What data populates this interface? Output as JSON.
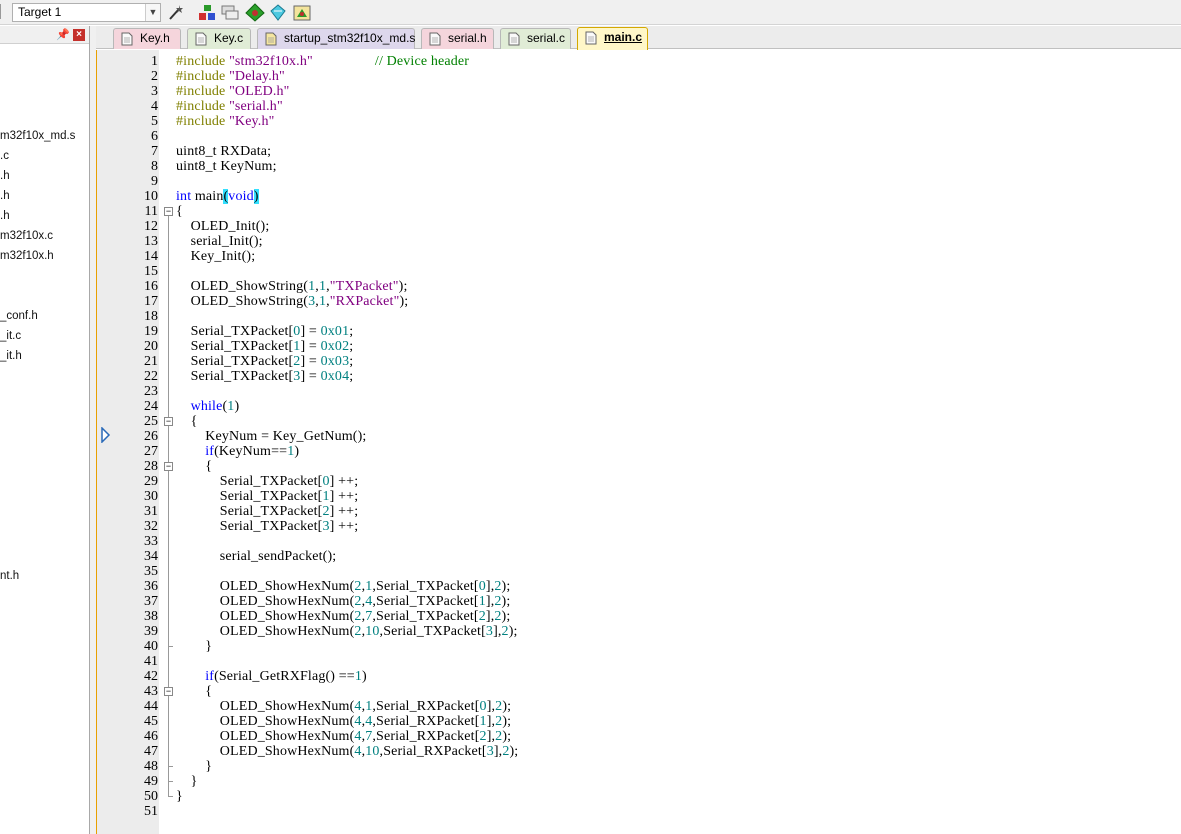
{
  "toolbar": {
    "target": "Target 1",
    "buttons": [
      "wand-icon",
      "load-icon",
      "multi-project-icon",
      "manage-components-icon",
      "select-packs-icon",
      "runtime-env-icon"
    ]
  },
  "sidebar": {
    "pin": "p",
    "close": "×",
    "items": [
      {
        "label": "m32f10x_md.s",
        "row": 0
      },
      {
        "label": ".c",
        "row": 1
      },
      {
        "label": ".h",
        "row": 2
      },
      {
        "label": ".h",
        "row": 3
      },
      {
        "label": ".h",
        "row": 4
      },
      {
        "label": "m32f10x.c",
        "row": 5
      },
      {
        "label": "m32f10x.h",
        "row": 6
      },
      {
        "label": "_conf.h",
        "row": 9
      },
      {
        "label": "_it.c",
        "row": 10
      },
      {
        "label": "_it.h",
        "row": 11
      },
      {
        "label": "nt.h",
        "row": 22
      }
    ]
  },
  "tabs": [
    {
      "label": "Key.h",
      "kind": "h"
    },
    {
      "label": "Key.c",
      "kind": "c"
    },
    {
      "label": "startup_stm32f10x_md.s",
      "kind": "s"
    },
    {
      "label": "serial.h",
      "kind": "h"
    },
    {
      "label": "serial.c",
      "kind": "c"
    },
    {
      "label": "main.c",
      "kind": "c",
      "active": true
    }
  ],
  "editor": {
    "current_line": 26,
    "folds": [
      11,
      25,
      28,
      43
    ],
    "lines": [
      {
        "n": "1",
        "tokens": [
          [
            "pp",
            "#include "
          ],
          [
            "str",
            "\"stm32f10x.h\""
          ],
          [
            "",
            "                 "
          ],
          [
            "cm",
            "// Device header"
          ]
        ]
      },
      {
        "n": "2",
        "tokens": [
          [
            "pp",
            "#include "
          ],
          [
            "str",
            "\"Delay.h\""
          ]
        ]
      },
      {
        "n": "3",
        "tokens": [
          [
            "pp",
            "#include "
          ],
          [
            "str",
            "\"OLED.h\""
          ]
        ]
      },
      {
        "n": "4",
        "tokens": [
          [
            "pp",
            "#include "
          ],
          [
            "str",
            "\"serial.h\""
          ]
        ]
      },
      {
        "n": "5",
        "tokens": [
          [
            "pp",
            "#include "
          ],
          [
            "str",
            "\"Key.h\""
          ]
        ]
      },
      {
        "n": "6",
        "tokens": []
      },
      {
        "n": "7",
        "tokens": [
          [
            "",
            "uint8_t RXData;"
          ]
        ]
      },
      {
        "n": "8",
        "tokens": [
          [
            "",
            "uint8_t KeyNum;"
          ]
        ]
      },
      {
        "n": "9",
        "tokens": []
      },
      {
        "n": "10",
        "tokens": [
          [
            "kw",
            "int"
          ],
          [
            "",
            " main"
          ],
          [
            "hl",
            "("
          ],
          [
            "kw",
            "void"
          ],
          [
            "hl",
            ")"
          ]
        ]
      },
      {
        "n": "11",
        "tokens": [
          [
            "",
            "{"
          ]
        ]
      },
      {
        "n": "12",
        "tokens": [
          [
            "",
            "    OLED_Init();"
          ]
        ]
      },
      {
        "n": "13",
        "tokens": [
          [
            "",
            "    serial_Init();"
          ]
        ]
      },
      {
        "n": "14",
        "tokens": [
          [
            "",
            "    Key_Init();"
          ]
        ]
      },
      {
        "n": "15",
        "tokens": []
      },
      {
        "n": "16",
        "tokens": [
          [
            "",
            "    OLED_ShowString("
          ],
          [
            "num",
            "1"
          ],
          [
            "",
            ","
          ],
          [
            "num",
            "1"
          ],
          [
            "",
            ","
          ],
          [
            "str",
            "\"TXPacket\""
          ],
          [
            "",
            ");"
          ]
        ]
      },
      {
        "n": "17",
        "tokens": [
          [
            "",
            "    OLED_ShowString("
          ],
          [
            "num",
            "3"
          ],
          [
            "",
            ","
          ],
          [
            "num",
            "1"
          ],
          [
            "",
            ","
          ],
          [
            "str",
            "\"RXPacket\""
          ],
          [
            "",
            ");"
          ]
        ]
      },
      {
        "n": "18",
        "tokens": []
      },
      {
        "n": "19",
        "tokens": [
          [
            "",
            "    Serial_TXPacket["
          ],
          [
            "num",
            "0"
          ],
          [
            "",
            "] = "
          ],
          [
            "num",
            "0x01"
          ],
          [
            "",
            ";"
          ]
        ]
      },
      {
        "n": "20",
        "tokens": [
          [
            "",
            "    Serial_TXPacket["
          ],
          [
            "num",
            "1"
          ],
          [
            "",
            "] = "
          ],
          [
            "num",
            "0x02"
          ],
          [
            "",
            ";"
          ]
        ]
      },
      {
        "n": "21",
        "tokens": [
          [
            "",
            "    Serial_TXPacket["
          ],
          [
            "num",
            "2"
          ],
          [
            "",
            "] = "
          ],
          [
            "num",
            "0x03"
          ],
          [
            "",
            ";"
          ]
        ]
      },
      {
        "n": "22",
        "tokens": [
          [
            "",
            "    Serial_TXPacket["
          ],
          [
            "num",
            "3"
          ],
          [
            "",
            "] = "
          ],
          [
            "num",
            "0x04"
          ],
          [
            "",
            ";"
          ]
        ]
      },
      {
        "n": "23",
        "tokens": []
      },
      {
        "n": "24",
        "tokens": [
          [
            "kw",
            "    while"
          ],
          [
            "",
            "("
          ],
          [
            "num",
            "1"
          ],
          [
            "",
            ")"
          ]
        ]
      },
      {
        "n": "25",
        "tokens": [
          [
            "",
            "    {"
          ]
        ]
      },
      {
        "n": "26",
        "tokens": [
          [
            "",
            "        KeyNum = Key_GetNum();"
          ]
        ]
      },
      {
        "n": "27",
        "tokens": [
          [
            "kw",
            "        if"
          ],
          [
            "",
            "(KeyNum=="
          ],
          [
            "num",
            "1"
          ],
          [
            "",
            ")"
          ]
        ]
      },
      {
        "n": "28",
        "tokens": [
          [
            "",
            "        {"
          ]
        ]
      },
      {
        "n": "29",
        "tokens": [
          [
            "",
            "            Serial_TXPacket["
          ],
          [
            "num",
            "0"
          ],
          [
            "",
            "] ++;"
          ]
        ]
      },
      {
        "n": "30",
        "tokens": [
          [
            "",
            "            Serial_TXPacket["
          ],
          [
            "num",
            "1"
          ],
          [
            "",
            "] ++;"
          ]
        ]
      },
      {
        "n": "31",
        "tokens": [
          [
            "",
            "            Serial_TXPacket["
          ],
          [
            "num",
            "2"
          ],
          [
            "",
            "] ++;"
          ]
        ]
      },
      {
        "n": "32",
        "tokens": [
          [
            "",
            "            Serial_TXPacket["
          ],
          [
            "num",
            "3"
          ],
          [
            "",
            "] ++;"
          ]
        ]
      },
      {
        "n": "33",
        "tokens": []
      },
      {
        "n": "34",
        "tokens": [
          [
            "",
            "            serial_sendPacket();"
          ]
        ]
      },
      {
        "n": "35",
        "tokens": []
      },
      {
        "n": "36",
        "tokens": [
          [
            "",
            "            OLED_ShowHexNum("
          ],
          [
            "num",
            "2"
          ],
          [
            "",
            ","
          ],
          [
            "num",
            "1"
          ],
          [
            "",
            ",Serial_TXPacket["
          ],
          [
            "num",
            "0"
          ],
          [
            "",
            "],"
          ],
          [
            "num",
            "2"
          ],
          [
            "",
            ");"
          ]
        ]
      },
      {
        "n": "37",
        "tokens": [
          [
            "",
            "            OLED_ShowHexNum("
          ],
          [
            "num",
            "2"
          ],
          [
            "",
            ","
          ],
          [
            "num",
            "4"
          ],
          [
            "",
            ",Serial_TXPacket["
          ],
          [
            "num",
            "1"
          ],
          [
            "",
            "],"
          ],
          [
            "num",
            "2"
          ],
          [
            "",
            ");"
          ]
        ]
      },
      {
        "n": "38",
        "tokens": [
          [
            "",
            "            OLED_ShowHexNum("
          ],
          [
            "num",
            "2"
          ],
          [
            "",
            ","
          ],
          [
            "num",
            "7"
          ],
          [
            "",
            ",Serial_TXPacket["
          ],
          [
            "num",
            "2"
          ],
          [
            "",
            "],"
          ],
          [
            "num",
            "2"
          ],
          [
            "",
            ");"
          ]
        ]
      },
      {
        "n": "39",
        "tokens": [
          [
            "",
            "            OLED_ShowHexNum("
          ],
          [
            "num",
            "2"
          ],
          [
            "",
            ","
          ],
          [
            "num",
            "10"
          ],
          [
            "",
            ",Serial_TXPacket["
          ],
          [
            "num",
            "3"
          ],
          [
            "",
            "],"
          ],
          [
            "num",
            "2"
          ],
          [
            "",
            ");"
          ]
        ]
      },
      {
        "n": "40",
        "tokens": [
          [
            "",
            "        }"
          ]
        ]
      },
      {
        "n": "41",
        "tokens": []
      },
      {
        "n": "42",
        "tokens": [
          [
            "kw",
            "        if"
          ],
          [
            "",
            "(Serial_GetRXFlag() =="
          ],
          [
            "num",
            "1"
          ],
          [
            "",
            ")"
          ]
        ]
      },
      {
        "n": "43",
        "tokens": [
          [
            "",
            "        {"
          ]
        ]
      },
      {
        "n": "44",
        "tokens": [
          [
            "",
            "            OLED_ShowHexNum("
          ],
          [
            "num",
            "4"
          ],
          [
            "",
            ","
          ],
          [
            "num",
            "1"
          ],
          [
            "",
            ",Serial_RXPacket["
          ],
          [
            "num",
            "0"
          ],
          [
            "",
            "],"
          ],
          [
            "num",
            "2"
          ],
          [
            "",
            ");"
          ]
        ]
      },
      {
        "n": "45",
        "tokens": [
          [
            "",
            "            OLED_ShowHexNum("
          ],
          [
            "num",
            "4"
          ],
          [
            "",
            ","
          ],
          [
            "num",
            "4"
          ],
          [
            "",
            ",Serial_RXPacket["
          ],
          [
            "num",
            "1"
          ],
          [
            "",
            "],"
          ],
          [
            "num",
            "2"
          ],
          [
            "",
            ");"
          ]
        ]
      },
      {
        "n": "46",
        "tokens": [
          [
            "",
            "            OLED_ShowHexNum("
          ],
          [
            "num",
            "4"
          ],
          [
            "",
            ","
          ],
          [
            "num",
            "7"
          ],
          [
            "",
            ",Serial_RXPacket["
          ],
          [
            "num",
            "2"
          ],
          [
            "",
            "],"
          ],
          [
            "num",
            "2"
          ],
          [
            "",
            ");"
          ]
        ]
      },
      {
        "n": "47",
        "tokens": [
          [
            "",
            "            OLED_ShowHexNum("
          ],
          [
            "num",
            "4"
          ],
          [
            "",
            ","
          ],
          [
            "num",
            "10"
          ],
          [
            "",
            ",Serial_RXPacket["
          ],
          [
            "num",
            "3"
          ],
          [
            "",
            "],"
          ],
          [
            "num",
            "2"
          ],
          [
            "",
            ");"
          ]
        ]
      },
      {
        "n": "48",
        "tokens": [
          [
            "",
            "        }"
          ]
        ]
      },
      {
        "n": "49",
        "tokens": [
          [
            "",
            "    }"
          ]
        ]
      },
      {
        "n": "50",
        "tokens": [
          [
            "",
            "}"
          ]
        ]
      },
      {
        "n": "51",
        "tokens": []
      }
    ]
  }
}
